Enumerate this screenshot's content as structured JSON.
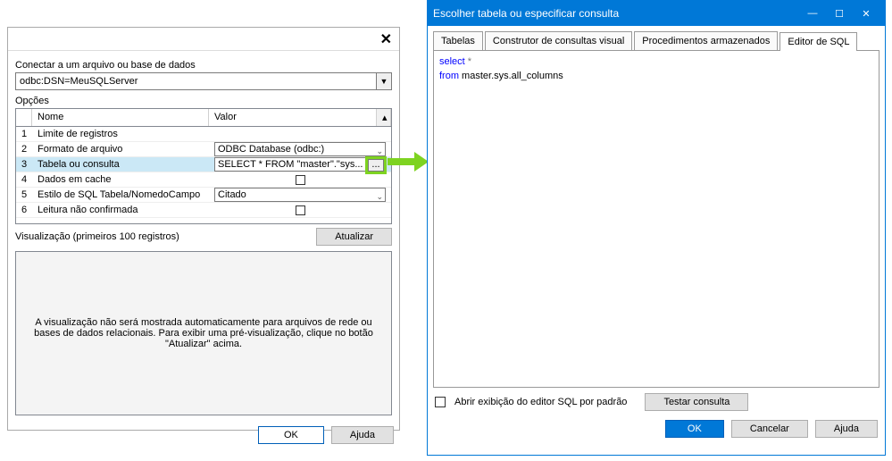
{
  "dlg1": {
    "connect_lbl": "Conectar a um arquivo ou base de dados",
    "dsn": "odbc:DSN=MeuSQLServer",
    "options_lbl": "Opções",
    "col_name": "Nome",
    "col_value": "Valor",
    "rows": [
      {
        "n": "1",
        "name": "Limite de registros",
        "val": ""
      },
      {
        "n": "2",
        "name": "Formato de arquivo",
        "val": "ODBC Database (odbc:)"
      },
      {
        "n": "3",
        "name": "Tabela ou consulta",
        "val": "SELECT * FROM \"master\".\"sys..."
      },
      {
        "n": "4",
        "name": "Dados em cache",
        "val": ""
      },
      {
        "n": "5",
        "name": "Estilo de SQL Tabela/NomedoCampo",
        "val": "Citado"
      },
      {
        "n": "6",
        "name": "Leitura não confirmada",
        "val": ""
      }
    ],
    "preview_lbl": "Visualização (primeiros 100 registros)",
    "update_btn": "Atualizar",
    "preview_text": "A visualização não será mostrada automaticamente para arquivos de rede ou bases de dados relacionais. Para exibir uma pré-visualização, clique no botão \"Atualizar\" acima.",
    "ok": "OK",
    "help": "Ajuda"
  },
  "dlg2": {
    "title": "Escolher tabela ou especificar consulta",
    "tabs": [
      "Tabelas",
      "Construtor de consultas visual",
      "Procedimentos armazenados",
      "Editor de SQL"
    ],
    "sql_kw1": "select",
    "sql_star": " *",
    "sql_kw2": "from",
    "sql_id": " master.sys.all_columns",
    "check_lbl": "Abrir exibição do editor SQL por padrão",
    "test_btn": "Testar consulta",
    "ok": "OK",
    "cancel": "Cancelar",
    "help": "Ajuda"
  }
}
